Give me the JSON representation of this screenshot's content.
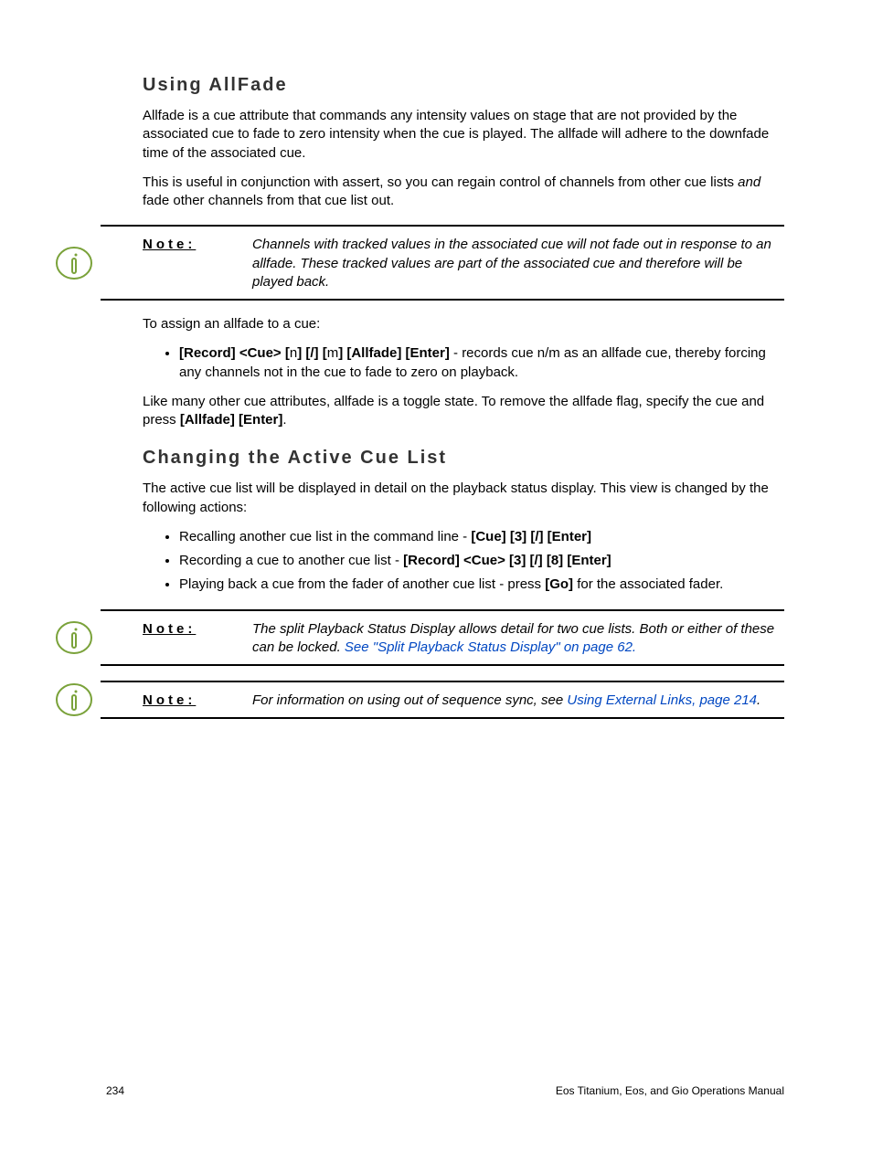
{
  "section1": {
    "title": "Using AllFade",
    "p1": "Allfade is a cue attribute that commands any intensity values on stage that are not provided by the associated cue to fade to zero intensity when the cue is played. The allfade will adhere to the downfade time of the associated cue.",
    "p2_a": "This is useful in conjunction with assert, so you can regain control of channels from other cue lists ",
    "p2_b": "and",
    "p2_c": " fade other channels from that cue list out."
  },
  "note1": {
    "label": "Note:",
    "body": "Channels with tracked values in the associated cue will not fade out in response to an allfade. These tracked values are part of the associated cue and therefore will be played back."
  },
  "assign": {
    "intro": "To assign an allfade to a cue:",
    "li1_a": "[Record] <Cue> [",
    "li1_b": "n",
    "li1_c": "] [/] [",
    "li1_d": "m",
    "li1_e": "] [Allfade] [Enter]",
    "li1_f": " - records cue n/m as an allfade cue, thereby forcing any channels not in the cue to fade to zero on playback.",
    "p_after_a": "Like many other cue attributes, allfade is a toggle state. To remove the allfade flag, specify the cue and press ",
    "p_after_b": "[Allfade] [Enter]",
    "p_after_c": "."
  },
  "section2": {
    "title": "Changing the Active Cue List",
    "p1": "The active cue list will be displayed in detail on the playback status display. This view is changed by the following actions:",
    "li1_a": "Recalling another cue list in the command line - ",
    "li1_b": "[Cue] [3] [/] [Enter]",
    "li2_a": "Recording a cue to another cue list - ",
    "li2_b": "[Record] <Cue> [3] [/] [8] [Enter]",
    "li3_a": "Playing back a cue from the fader of another cue list - press ",
    "li3_b": "[Go]",
    "li3_c": " for the associated fader."
  },
  "note2": {
    "label": "Note:",
    "body_a": "The split Playback Status Display allows detail for two cue lists. Both or either of these can be locked. ",
    "link": "See \"Split Playback Status Display\" on page 62."
  },
  "note3": {
    "label": "Note:",
    "body_a": "For information on using out of sequence sync, see ",
    "link": "Using External Links, page 214",
    "body_b": "."
  },
  "footer": {
    "page": "234",
    "title": "Eos Titanium, Eos, and Gio Operations Manual"
  }
}
